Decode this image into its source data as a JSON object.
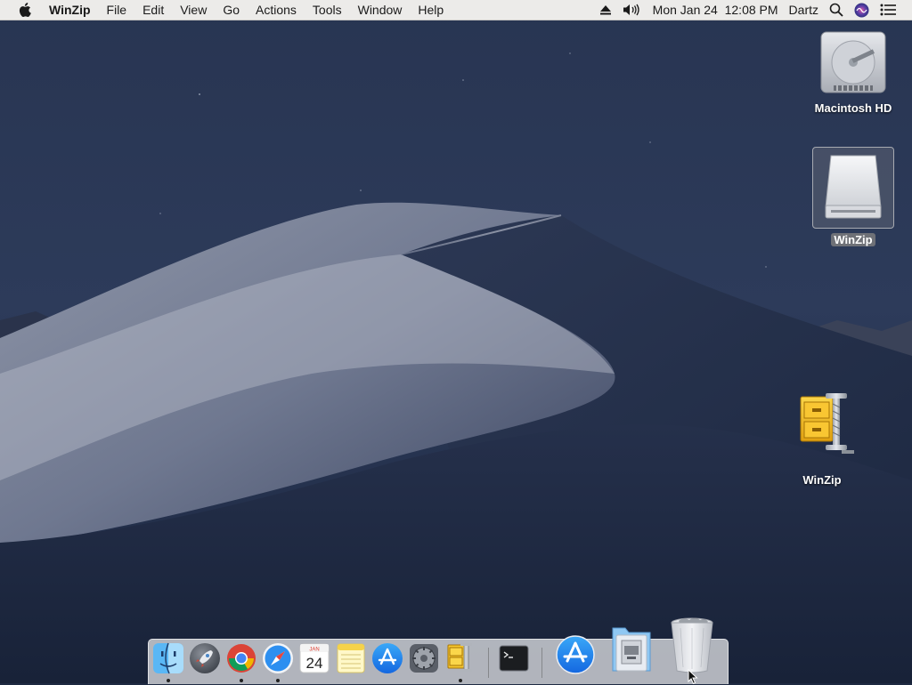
{
  "menubar": {
    "app_name": "WinZip",
    "menus": [
      "File",
      "Edit",
      "View",
      "Go",
      "Actions",
      "Tools",
      "Window",
      "Help"
    ],
    "clock": "Mon Jan 24  12:08 PM",
    "user": "Dartz",
    "status_icons": [
      "eject-icon",
      "volume-icon",
      "spotlight-search-icon",
      "siri-icon",
      "notification-center-icon"
    ]
  },
  "desktop": {
    "icons": [
      {
        "label": "Macintosh HD",
        "icon": "hard-drive-icon"
      },
      {
        "label": "WinZip",
        "icon": "external-disk-icon",
        "selected": true
      },
      {
        "label": "WinZip",
        "icon": "winzip-app-icon"
      }
    ]
  },
  "dock": {
    "apps": [
      {
        "name": "Finder",
        "icon": "finder-icon",
        "running": true
      },
      {
        "name": "Launchpad",
        "icon": "launchpad-rocket-icon",
        "running": false
      },
      {
        "name": "Google Chrome",
        "icon": "chrome-icon",
        "running": true
      },
      {
        "name": "Safari",
        "icon": "safari-compass-icon",
        "running": true
      },
      {
        "name": "Calendar",
        "icon": "calendar-icon",
        "running": false,
        "month": "JAN",
        "day": "24"
      },
      {
        "name": "Notes",
        "icon": "notes-icon",
        "running": false
      },
      {
        "name": "App Store",
        "icon": "app-store-icon",
        "running": false
      },
      {
        "name": "System Preferences",
        "icon": "gear-icon",
        "running": false
      },
      {
        "name": "WinZip",
        "icon": "winzip-app-icon",
        "running": true
      },
      {
        "name": "Terminal",
        "icon": "terminal-icon",
        "running": false
      }
    ],
    "stacks": [
      {
        "name": "Applications",
        "icon": "app-store-icon"
      },
      {
        "name": "Downloads",
        "icon": "downloads-folder-icon"
      },
      {
        "name": "Trash",
        "icon": "trash-full-icon"
      }
    ]
  },
  "colors": {
    "menubar_bg": "#ecebe9",
    "sky": "#1e2a42",
    "dune_light": "#a3a8b6",
    "accent_blue": "#1c7cf4",
    "winzip_yellow": "#f5c518"
  }
}
